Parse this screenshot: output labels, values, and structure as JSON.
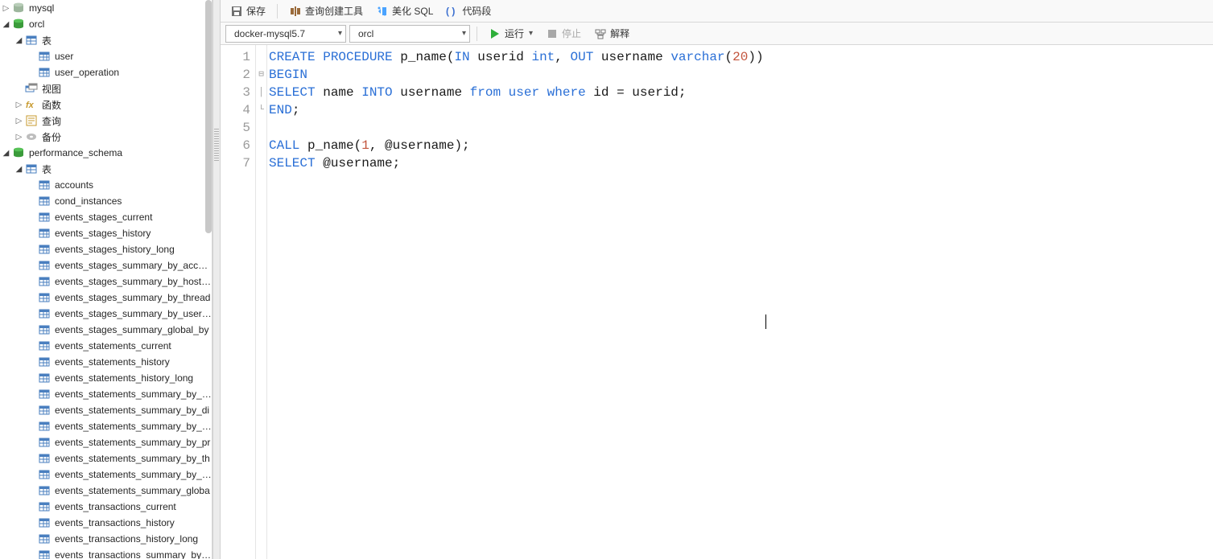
{
  "sidebar": {
    "items": [
      {
        "indent": 0,
        "tog": "▸",
        "icon": "db-dim",
        "label": "mysql"
      },
      {
        "indent": 0,
        "tog": "▾",
        "icon": "db",
        "label": "orcl"
      },
      {
        "indent": 1,
        "tog": "▾",
        "icon": "tables",
        "label": "表"
      },
      {
        "indent": 2,
        "tog": "",
        "icon": "table",
        "label": "user"
      },
      {
        "indent": 2,
        "tog": "",
        "icon": "table",
        "label": "user_operation"
      },
      {
        "indent": 1,
        "tog": "",
        "icon": "view",
        "label": "视图"
      },
      {
        "indent": 1,
        "tog": "▸",
        "icon": "fx",
        "label": "函数"
      },
      {
        "indent": 1,
        "tog": "▸",
        "icon": "query",
        "label": "查询"
      },
      {
        "indent": 1,
        "tog": "▸",
        "icon": "backup",
        "label": "备份"
      },
      {
        "indent": 0,
        "tog": "▾",
        "icon": "db",
        "label": "performance_schema"
      },
      {
        "indent": 1,
        "tog": "▾",
        "icon": "tables",
        "label": "表"
      },
      {
        "indent": 2,
        "tog": "",
        "icon": "table",
        "label": "accounts"
      },
      {
        "indent": 2,
        "tog": "",
        "icon": "table",
        "label": "cond_instances"
      },
      {
        "indent": 2,
        "tog": "",
        "icon": "table",
        "label": "events_stages_current"
      },
      {
        "indent": 2,
        "tog": "",
        "icon": "table",
        "label": "events_stages_history"
      },
      {
        "indent": 2,
        "tog": "",
        "icon": "table",
        "label": "events_stages_history_long"
      },
      {
        "indent": 2,
        "tog": "",
        "icon": "table",
        "label": "events_stages_summary_by_account"
      },
      {
        "indent": 2,
        "tog": "",
        "icon": "table",
        "label": "events_stages_summary_by_host_by"
      },
      {
        "indent": 2,
        "tog": "",
        "icon": "table",
        "label": "events_stages_summary_by_thread"
      },
      {
        "indent": 2,
        "tog": "",
        "icon": "table",
        "label": "events_stages_summary_by_user_b"
      },
      {
        "indent": 2,
        "tog": "",
        "icon": "table",
        "label": "events_stages_summary_global_by"
      },
      {
        "indent": 2,
        "tog": "",
        "icon": "table",
        "label": "events_statements_current"
      },
      {
        "indent": 2,
        "tog": "",
        "icon": "table",
        "label": "events_statements_history"
      },
      {
        "indent": 2,
        "tog": "",
        "icon": "table",
        "label": "events_statements_history_long"
      },
      {
        "indent": 2,
        "tog": "",
        "icon": "table",
        "label": "events_statements_summary_by_ac"
      },
      {
        "indent": 2,
        "tog": "",
        "icon": "table",
        "label": "events_statements_summary_by_di"
      },
      {
        "indent": 2,
        "tog": "",
        "icon": "table",
        "label": "events_statements_summary_by_ho"
      },
      {
        "indent": 2,
        "tog": "",
        "icon": "table",
        "label": "events_statements_summary_by_pr"
      },
      {
        "indent": 2,
        "tog": "",
        "icon": "table",
        "label": "events_statements_summary_by_th"
      },
      {
        "indent": 2,
        "tog": "",
        "icon": "table",
        "label": "events_statements_summary_by_us"
      },
      {
        "indent": 2,
        "tog": "",
        "icon": "table",
        "label": "events_statements_summary_globa"
      },
      {
        "indent": 2,
        "tog": "",
        "icon": "table",
        "label": "events_transactions_current"
      },
      {
        "indent": 2,
        "tog": "",
        "icon": "table",
        "label": "events_transactions_history"
      },
      {
        "indent": 2,
        "tog": "",
        "icon": "table",
        "label": "events_transactions_history_long"
      },
      {
        "indent": 2,
        "tog": "",
        "icon": "table",
        "label": "events_transactions_summary_by_a"
      }
    ]
  },
  "toolbar1": {
    "save": "保存",
    "query_builder": "查询创建工具",
    "beautify": "美化 SQL",
    "snippet": "代码段"
  },
  "toolbar2": {
    "connection": "docker-mysql5.7",
    "database": "orcl",
    "run": "运行",
    "stop": "停止",
    "explain": "解释"
  },
  "icons": {
    "db": "database-icon",
    "db-dim": "database-icon-dim",
    "tables": "tables-group-icon",
    "table": "table-icon",
    "view": "view-icon",
    "fx": "function-icon",
    "query": "query-icon",
    "backup": "backup-icon"
  },
  "editor": {
    "lines": [
      {
        "n": 1,
        "fold": "",
        "tokens": [
          [
            "kw",
            "CREATE"
          ],
          [
            "",
            " "
          ],
          [
            "kw",
            "PROCEDURE"
          ],
          [
            "",
            " p_name("
          ],
          [
            "kw",
            "IN"
          ],
          [
            "",
            ", "
          ],
          [
            "",
            "userid "
          ],
          [
            "ty",
            "int"
          ],
          [
            "",
            ",  "
          ],
          [
            "kw",
            "OUT"
          ],
          [
            "",
            ", "
          ],
          [
            "",
            "username "
          ],
          [
            "ty",
            "varchar"
          ],
          [
            "",
            "("
          ],
          [
            "nm",
            "20"
          ],
          [
            "",
            "))"
          ]
        ]
      },
      {
        "n": 2,
        "fold": "⊟",
        "tokens": [
          [
            "kw",
            "BEGIN"
          ]
        ]
      },
      {
        "n": 3,
        "fold": "│",
        "tokens": [
          [
            "kw",
            "SELECT"
          ],
          [
            "",
            " name "
          ],
          [
            "kw",
            "INTO"
          ],
          [
            "",
            " username "
          ],
          [
            "kw",
            "from"
          ],
          [
            "",
            " "
          ],
          [
            "kw",
            "user"
          ],
          [
            "",
            " "
          ],
          [
            "kw",
            "where"
          ],
          [
            "",
            " id = userid;"
          ]
        ]
      },
      {
        "n": 4,
        "fold": "└",
        "tokens": [
          [
            "kw",
            "END"
          ],
          [
            "",
            ";"
          ]
        ]
      },
      {
        "n": 5,
        "fold": "",
        "tokens": [
          [
            "",
            ""
          ]
        ]
      },
      {
        "n": 6,
        "fold": "",
        "tokens": [
          [
            "kw",
            "CALL"
          ],
          [
            "",
            " p_name("
          ],
          [
            "nm",
            "1"
          ],
          [
            "",
            ", @username);"
          ]
        ]
      },
      {
        "n": 7,
        "fold": "",
        "tokens": [
          [
            "kw",
            "SELECT"
          ],
          [
            "",
            " @username;"
          ]
        ]
      }
    ],
    "fixed_lines": {
      "1": "CREATE PROCEDURE p_name(IN userid int, OUT username varchar(20))"
    }
  }
}
